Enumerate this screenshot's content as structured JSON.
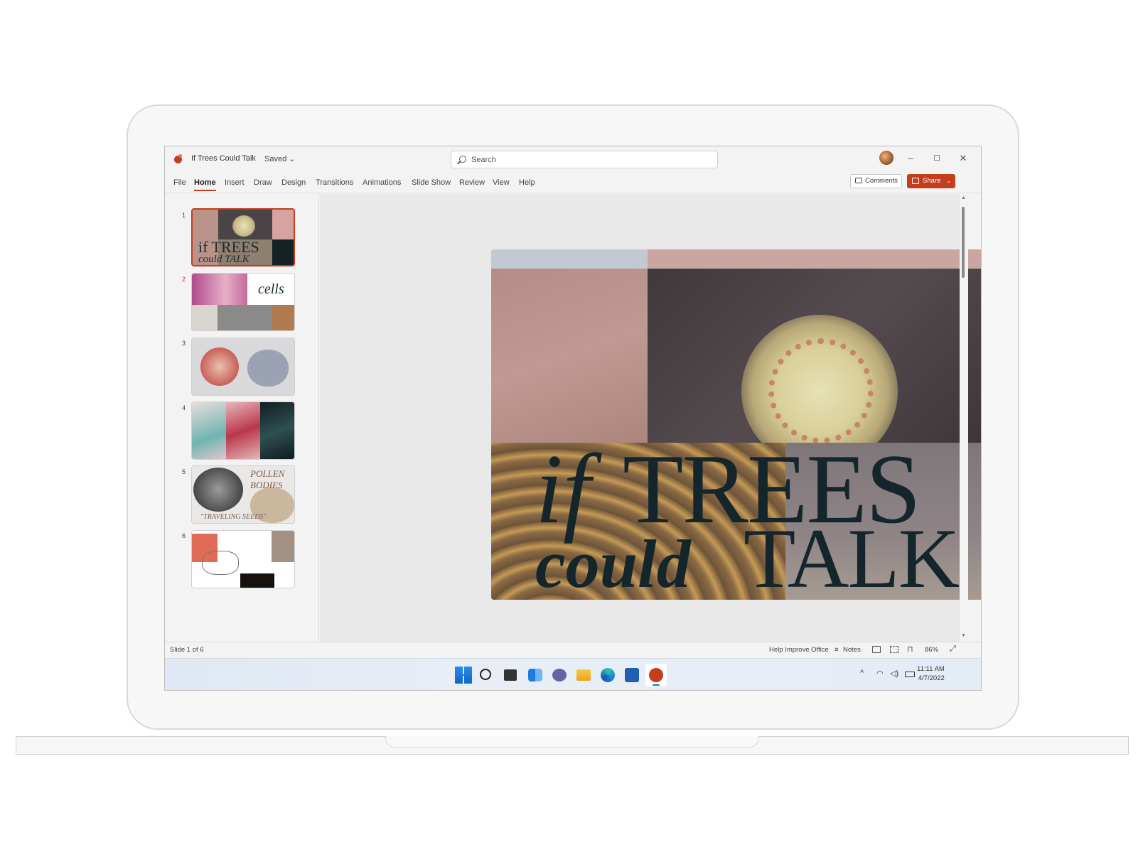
{
  "app": {
    "doc_title": "If Trees Could Talk",
    "saved_label": "Saved ⌄",
    "search_placeholder": "Search",
    "minimize": "–",
    "maximize": "☐",
    "close": "✕"
  },
  "ribbon": {
    "tabs": [
      "File",
      "Home",
      "Insert",
      "Draw",
      "Design",
      "Transitions",
      "Animations",
      "Slide Show",
      "Review",
      "View",
      "Help"
    ],
    "active_tab": "Home",
    "comments_label": "Comments",
    "share_label": "Share",
    "share_chevron": "⌄"
  },
  "slides": {
    "numbers": [
      "1",
      "2",
      "3",
      "4",
      "5",
      "6"
    ],
    "thumb1_text1": "if TREES",
    "thumb1_text2": "could TALK",
    "thumb2_text": "cells",
    "thumb5_text1": "POLLEN",
    "thumb5_text2": "BODIES",
    "thumb5_text3": "\"TRAVELING SEEDS\""
  },
  "slide_main": {
    "title_if": "if",
    "title_trees": "TREES",
    "title_could": "could",
    "title_talk": "TALK"
  },
  "status": {
    "slide_count": "Slide 1 of 6",
    "help_improve": "Help Improve Office",
    "notes_label": "Notes",
    "zoom": "86%"
  },
  "taskbar": {
    "clock_time": "11:11 AM",
    "clock_date": "4/7/2022",
    "tray_chevron": "^"
  },
  "colors": {
    "accent": "#c43e1c",
    "slide_text": "#14262c"
  }
}
